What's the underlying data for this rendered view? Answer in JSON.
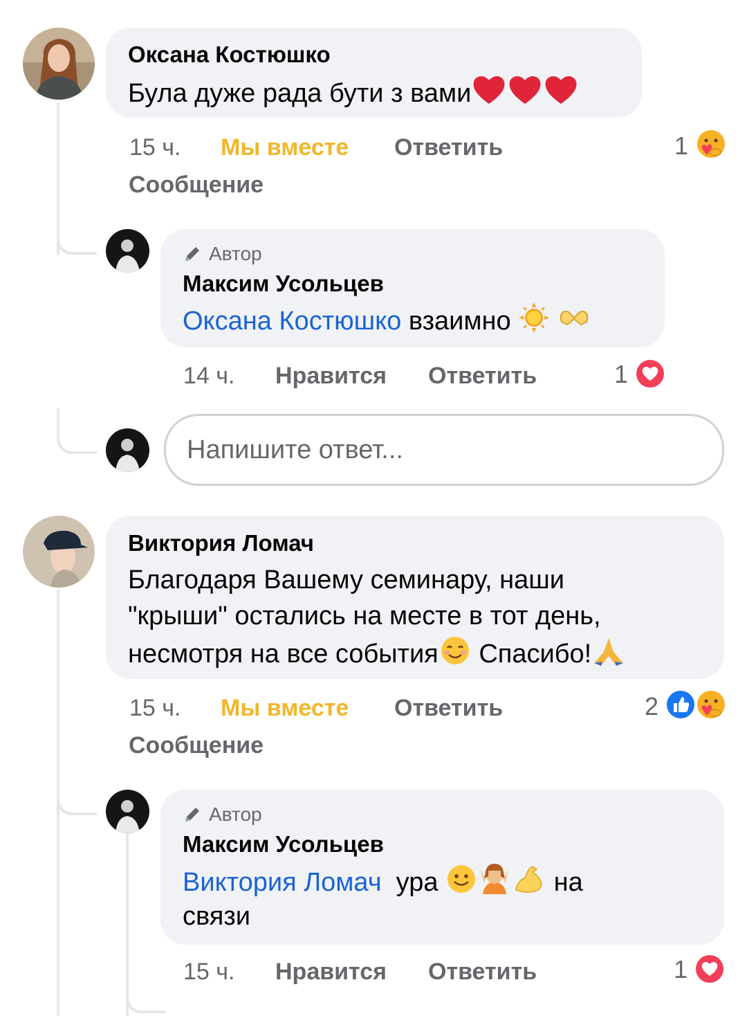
{
  "comments": [
    {
      "author": "Оксана Костюшко",
      "text": "Була дуже рада бути з вами",
      "time": "15 ч.",
      "reaction_label": "Мы вместе",
      "reply_label": "Ответить",
      "message_label": "Сообщение",
      "reaction_count": "1",
      "reply": {
        "badge": "Автор",
        "author": "Максим Усольцев",
        "mention": "Оксана Костюшко",
        "text": "взаимно",
        "time": "14 ч.",
        "like_label": "Нравится",
        "reply_label": "Ответить",
        "reaction_count": "1"
      },
      "input_placeholder": "Напишите ответ..."
    },
    {
      "author": "Виктория Ломач",
      "text_line1": "Благодаря Вашему семинару, наши",
      "text_line2": "\"крыши\" остались на месте в тот день,",
      "text_line3": "несмотря на все события",
      "text_line3_end": "Спасибо!",
      "time": "15 ч.",
      "reaction_label": "Мы вместе",
      "reply_label": "Ответить",
      "message_label": "Сообщение",
      "reaction_count": "2",
      "reply": {
        "badge": "Автор",
        "author": "Максим Усольцев",
        "mention": "Виктория Ломач",
        "text": "ура",
        "text_end": "на",
        "text_line2": "связи",
        "time": "15 ч.",
        "like_label": "Нравится",
        "reply_label": "Ответить",
        "reaction_count": "1"
      }
    }
  ],
  "colors": {
    "bubble": "#f0f2f5",
    "meta": "#65676b",
    "care_reaction": "#f1b62b",
    "mention": "#1a63d4",
    "love": "#f33e58",
    "like": "#1877f2"
  },
  "icons": [
    "pencil-icon",
    "heart-icon",
    "care-reaction-icon",
    "love-reaction-icon",
    "like-reaction-icon",
    "sun-icon",
    "heart-hands-icon",
    "smiling-face-icon",
    "pray-icon",
    "smile-icon",
    "person-gesturing-icon",
    "flexed-biceps-icon"
  ]
}
